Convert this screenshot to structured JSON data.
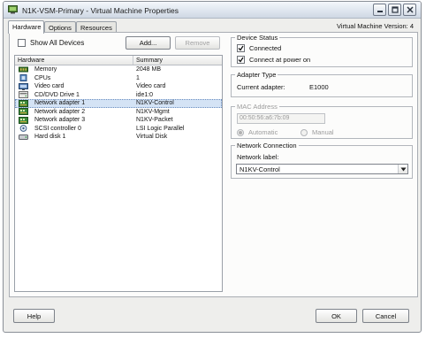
{
  "window": {
    "title": "N1K-VSM-Primary - Virtual Machine Properties"
  },
  "tabs": [
    "Hardware",
    "Options",
    "Resources"
  ],
  "vm_version": "Virtual Machine Version: 4",
  "hardware_panel": {
    "show_all_label": "Show All Devices",
    "show_all_checked": false,
    "add_label": "Add...",
    "remove_label": "Remove",
    "columns": [
      "Hardware",
      "Summary"
    ],
    "rows": [
      {
        "name": "Memory",
        "summary": "2048 MB",
        "icon": "memory-icon"
      },
      {
        "name": "CPUs",
        "summary": "1",
        "icon": "cpu-icon"
      },
      {
        "name": "Video card",
        "summary": "Video card",
        "icon": "video-card-icon"
      },
      {
        "name": "CD/DVD Drive 1",
        "summary": "ide1:0",
        "icon": "cd-dvd-icon"
      },
      {
        "name": "Network adapter 1",
        "summary": "N1KV-Control",
        "icon": "network-adapter-icon",
        "selected": true
      },
      {
        "name": "Network adapter 2",
        "summary": "N1KV-Mgmt",
        "icon": "network-adapter-icon"
      },
      {
        "name": "Network adapter 3",
        "summary": "N1KV-Packet",
        "icon": "network-adapter-icon"
      },
      {
        "name": "SCSI controller 0",
        "summary": "LSI Logic Parallel",
        "icon": "scsi-controller-icon"
      },
      {
        "name": "Hard disk 1",
        "summary": "Virtual Disk",
        "icon": "hard-disk-icon"
      }
    ]
  },
  "device_status": {
    "title": "Device Status",
    "connected_label": "Connected",
    "connected_checked": true,
    "connect_power_label": "Connect at power on",
    "connect_power_checked": true
  },
  "adapter_type": {
    "title": "Adapter Type",
    "current_label": "Current adapter:",
    "current_value": "E1000"
  },
  "mac_address": {
    "title": "MAC Address",
    "value": "00:50:56:a6:7b:09",
    "automatic_label": "Automatic",
    "manual_label": "Manual",
    "selected": "Automatic"
  },
  "network_connection": {
    "title": "Network Connection",
    "label": "Network label:",
    "value": "N1KV-Control"
  },
  "footer": {
    "help_label": "Help",
    "ok_label": "OK",
    "cancel_label": "Cancel"
  }
}
